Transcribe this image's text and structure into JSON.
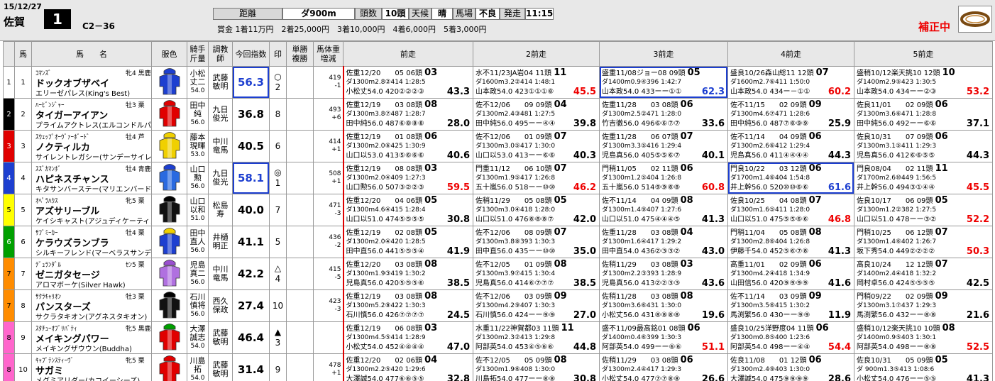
{
  "race": {
    "date": "15/12/27",
    "venue": "佐賀",
    "number": "1",
    "class": "C2－36",
    "dist_label": "距離",
    "dist": "ダ900m",
    "heads_label": "頭数",
    "heads": "10頭",
    "weather_label": "天候",
    "weather": "晴",
    "track_label": "馬場",
    "track": "不良",
    "start_label": "発走",
    "start": "11:15",
    "prize": "賞金 1着11万円　2着25,000円　3着10,000円　4着6,000円　5着3,000円",
    "hosei": "補正中"
  },
  "headers": {
    "waku": "",
    "ban": "馬",
    "horse": "馬　　名",
    "silks": "服色",
    "jockey": "騎手\n斤量",
    "trainer": "調教\n師",
    "index": "今回指数",
    "mark": "印",
    "odds": "単勝\n複勝",
    "bw": "馬体重\n増減",
    "prev1": "前走",
    "prev2": "2前走",
    "prev3": "3前走",
    "prev4": "4前走",
    "prev5": "5前走"
  },
  "waku_colors": [
    "#ffffff",
    "#000000",
    "#e00000",
    "#1d3fd0",
    "#ffff00",
    "#00a000",
    "#ff8c00",
    "#ff8c00",
    "#ff66cc",
    "#ff66cc"
  ],
  "horses": [
    {
      "waku": "1",
      "ban": "1",
      "sire": "ｺﾏﾝｽﾞ",
      "sex": "牝4 黒鹿",
      "name": "ドックオブザベイ",
      "dam": "エリーゼパレス(King's Best)",
      "jockey1": "小松",
      "jockey2": "丈二",
      "weight": "54.0",
      "trainer1": "武藤",
      "trainer2": "敏明",
      "index": "56.3",
      "idx_hl": true,
      "mark": "○",
      "mark_no": "2",
      "bw1": "419",
      "bw2": "-1",
      "prev": [
        {
          "l1": "佐重12/20　　05 06頭",
          "ord": "03",
          "l2": "ダ1300m2.8②414 1:28:5",
          "l3": "小松丈54.0 420②②②③",
          "v": "43.3",
          "vc": ""
        },
        {
          "l1": "水不11/23JA岩04 11頭",
          "ord": "11",
          "l2": "ダ1600m3.2②414 1:48:1",
          "l3": "山本政54.0 423①①①⑧",
          "v": "45.5",
          "vc": "red"
        },
        {
          "l1": "盛重11/08ジョー08 09頭",
          "ord": "05",
          "l2": "ダ1400m0.9④396 1:42:7",
          "l3": "山本政54.0 433ーー①①",
          "v": "62.3",
          "vc": "blue",
          "hl": true
        },
        {
          "l1": "盛良10/26森山総11 12頭",
          "ord": "07",
          "l2": "ダ1600m2.7⑥411 1:50:0",
          "l3": "山本政54.0 434ー－①①",
          "v": "60.2",
          "vc": "red"
        },
        {
          "l1": "盛稍10/12楽天挑10 12頭",
          "ord": "10",
          "l2": "ダ1400m2.9⑤423 1:30:5",
          "l3": "山本政54.0 434ーー②③",
          "v": "53.2",
          "vc": "red"
        }
      ]
    },
    {
      "waku": "2",
      "ban": "2",
      "sire": "ﾊｰﾋﾞﾝｼﾞｬｰ",
      "sex": "牡3 栗",
      "name": "タイガーアイアン",
      "dam": "プライムアクトレス(エルコンドルパサー)",
      "jockey1": "田中",
      "jockey2": "純",
      "weight": "56.0",
      "trainer1": "九日",
      "trainer2": "俊光",
      "index": "36.8",
      "idx_hl": false,
      "mark": "",
      "mark_no": "8",
      "bw1": "493",
      "bw2": "+6",
      "prev": [
        {
          "l1": "佐重12/19　　03 08頭",
          "ord": "08",
          "l2": "ダ1300m3.8⑦487 1:28:7",
          "l3": "田中純56.0 487⑥⑧⑧⑧",
          "v": "28.0",
          "vc": ""
        },
        {
          "l1": "佐不12/06　　09 09頭",
          "ord": "04",
          "l2": "ダ1300m2.4③481 1:27:5",
          "l3": "田中純56.0 495ーー④④",
          "v": "39.8",
          "vc": ""
        },
        {
          "l1": "佐重11/28　　03 08頭",
          "ord": "06",
          "l2": "ダ1300m2.5②471 1:28:0",
          "l3": "竹吉徹56.0 496⑥⑥⑦⑦",
          "v": "33.6",
          "vc": ""
        },
        {
          "l1": "佐不11/15　　02 09頭",
          "ord": "09",
          "l2": "ダ1300m4.6⑦471 1:28:6",
          "l3": "田中純56.0 487⑦⑧⑨⑨",
          "v": "25.9",
          "vc": ""
        },
        {
          "l1": "佐良11/01　　02 09頭",
          "ord": "06",
          "l2": "ダ1300m3.6⑥471 1:28:8",
          "l3": "田中純56.0 492ーー⑥⑥",
          "v": "37.1",
          "vc": ""
        }
      ]
    },
    {
      "waku": "3",
      "ban": "3",
      "sire": "ｽｳｪｯﾌﾟｵｰｳﾞｧｰﾎﾞｰﾄﾞ",
      "sex": "牡4 芦",
      "name": "ノクティルカ",
      "dam": "サイレントレガシー(サンデーサイレンス)",
      "jockey1": "藤本",
      "jockey2": "現暉",
      "weight": "53.0",
      "trainer1": "中川",
      "trainer2": "竜馬",
      "index": "40.5",
      "idx_hl": false,
      "mark": "",
      "mark_no": "6",
      "bw1": "414",
      "bw2": "+1",
      "prev": [
        {
          "l1": "佐重12/19　　01 08頭",
          "ord": "06",
          "l2": "ダ1300m2.0⑥425 1:30:9",
          "l3": "山口以53.0 413⑤⑥⑥⑥",
          "v": "40.6",
          "vc": ""
        },
        {
          "l1": "佐不12/06　　01 09頭",
          "ord": "07",
          "l2": "ダ1300m3.0⑤417 1:30:0",
          "l3": "山口以53.0 413ーー⑥⑥",
          "v": "40.3",
          "vc": ""
        },
        {
          "l1": "佐重11/28　　06 07頭",
          "ord": "07",
          "l2": "ダ1300m3.3⑤416 1:29:4",
          "l3": "児島真56.0 405⑤⑤⑥⑦",
          "v": "40.1",
          "vc": ""
        },
        {
          "l1": "佐不11/14　　04 09頭",
          "ord": "06",
          "l2": "ダ1300m2.6⑥412 1:29:4",
          "l3": "児島真56.0 411④④④④",
          "v": "44.3",
          "vc": ""
        },
        {
          "l1": "佐良10/31　　07 09頭",
          "ord": "06",
          "l2": "ダ1300m3.1⑤411 1:29:3",
          "l3": "児島真56.0 412⑥⑥⑤⑤",
          "v": "44.3",
          "vc": ""
        }
      ]
    },
    {
      "waku": "4",
      "ban": "4",
      "sire": "ｽｽﾞｶﾏﾝﾎﾞ",
      "sex": "牡4 青鹿",
      "name": "ハピネスチャンス",
      "dam": "キタサンバーステー(マリエンバード)",
      "jockey1": "山口",
      "jockey2": "勲",
      "weight": "56.0",
      "trainer1": "九日",
      "trainer2": "俊光",
      "index": "58.1",
      "idx_hl": true,
      "mark": "◎",
      "mark_no": "1",
      "bw1": "508",
      "bw2": "+1",
      "prev": [
        {
          "l1": "佐重12/19　　08 08頭",
          "ord": "03",
          "l2": "ダ1300m2.0④409 1:27:3",
          "l3": "山口勲56.0 507③②②③",
          "v": "59.5",
          "vc": "red"
        },
        {
          "l1": "門重11/12　　06 10頭",
          "ord": "07",
          "l2": "ダ1300m1.9⑤417 1:26:8",
          "l3": "五十嵐56.0 518ーー⑩⑩",
          "v": "46.2",
          "vc": "red"
        },
        {
          "l1": "門稍11/05　　02 11頭",
          "ord": "06",
          "l2": "ダ1300m1.2⑤404 1:26:8",
          "l3": "五十嵐56.0 514⑨⑨⑧⑧",
          "v": "60.8",
          "vc": "red"
        },
        {
          "l1": "門良10/22　　03 12頭",
          "ord": "06",
          "l2": "ダ1700m1.4⑥404 1:54:8",
          "l3": "井上幹56.0 520⑩⑩⑥⑥",
          "v": "61.6",
          "vc": "blue",
          "hl": true
        },
        {
          "l1": "門良08/04　　02 11頭",
          "ord": "11",
          "l2": "ダ1700m2.6⑩449 1:56:5",
          "l3": "井上幹56.0 494③①④④",
          "v": "45.5",
          "vc": "red"
        }
      ]
    },
    {
      "waku": "5",
      "ban": "5",
      "sire": "ｵﾍﾟﾗﾊｳｽ",
      "sex": "牝5 栗",
      "name": "アズサリーブル",
      "dam": "ケイシキャスト(アジュディケーティング)",
      "jockey1": "山口",
      "jockey2": "以和",
      "weight": "51.0",
      "trainer1": "松島",
      "trainer2": "寿",
      "index": "40.0",
      "idx_hl": false,
      "mark": "",
      "mark_no": "7",
      "bw1": "471",
      "bw2": "-3",
      "prev": [
        {
          "l1": "佐重12/20　　04 06頭",
          "ord": "05",
          "l2": "ダ1300m4.6④415 1:28:4",
          "l3": "山口以51.0 474⑤⑤⑤⑤",
          "v": "30.8",
          "vc": ""
        },
        {
          "l1": "佐稍11/29　　05 08頭",
          "ord": "05",
          "l2": "ダ1300m3.0④418 1:28:0",
          "l3": "山口以51.0 476⑧⑧⑧⑦",
          "v": "42.0",
          "vc": ""
        },
        {
          "l1": "佐不11/14　　04 09頭",
          "ord": "08",
          "l2": "ダ1300m1.4⑨407 1:27:6",
          "l3": "山口以51.0 475④④④⑤",
          "v": "41.3",
          "vc": ""
        },
        {
          "l1": "佐良10/25　　04 08頭",
          "ord": "07",
          "l2": "ダ1300m1.6⑤411 1:28:0",
          "l3": "山口以51.0 475⑤⑤⑥⑥",
          "v": "46.8",
          "vc": "red"
        },
        {
          "l1": "佐良10/17　　06 09頭",
          "ord": "05",
          "l2": "ダ1300m1.2②382 1:27:5",
          "l3": "山口以51.0 478ーー③②",
          "v": "52.2",
          "vc": "red"
        }
      ]
    },
    {
      "waku": "6",
      "ban": "6",
      "sire": "ｻﾌﾞﾐｰｶｰ",
      "sex": "牡4 栗",
      "name": "ケラウズランブラ",
      "dam": "シルキーフレンド(マーベラスサンデー)",
      "jockey1": "田中",
      "jockey2": "直人",
      "weight": "56.0",
      "trainer1": "井樋",
      "trainer2": "明正",
      "index": "41.1",
      "idx_hl": false,
      "mark": "",
      "mark_no": "5",
      "bw1": "436",
      "bw2": "-2",
      "prev": [
        {
          "l1": "佐重12/19　　02 08頭",
          "ord": "05",
          "l2": "ダ1300m2.0④420 1:28:5",
          "l3": "田中直56.0 441⑤⑤⑤④",
          "v": "41.9",
          "vc": ""
        },
        {
          "l1": "佐不12/06　　08 09頭",
          "ord": "07",
          "l2": "ダ1300m3.8⑧393 1:30:3",
          "l3": "田中直56.0 435ーー⑩⑩",
          "v": "35.0",
          "vc": ""
        },
        {
          "l1": "佐重11/28　　03 08頭",
          "ord": "04",
          "l2": "ダ1300m1.6④417 1:29:2",
          "l3": "田中直54.0 436②③③②",
          "v": "43.0",
          "vc": ""
        },
        {
          "l1": "門稍11/04　　05 08頭",
          "ord": "08",
          "l2": "ダ1300m2.8⑥404 1:26:8",
          "l3": "伊藤千54.0 452⑤⑥⑦⑧",
          "v": "41.3",
          "vc": ""
        },
        {
          "l1": "門稍10/25　　06 12頭",
          "ord": "07",
          "l2": "ダ1300m1.4⑥402 1:26:7",
          "l3": "坂下秀54.0 449②②②②",
          "v": "50.3",
          "vc": "red"
        }
      ]
    },
    {
      "waku": "7",
      "ban": "7",
      "sire": "ﾃﾞｭﾗﾝﾀﾞﾙ",
      "sex": "ｾﾝ5 栗",
      "name": "ゼニガタセージ",
      "dam": "アロマボーケ(Silver Hawk)",
      "jockey1": "児島",
      "jockey2": "真二",
      "weight": "56.0",
      "trainer1": "中川",
      "trainer2": "竜馬",
      "index": "42.2",
      "idx_hl": false,
      "mark": "△",
      "mark_no": "4",
      "bw1": "415",
      "bw2": "-5",
      "prev": [
        {
          "l1": "佐重12/20　　03 08頭",
          "ord": "08",
          "l2": "ダ1300m1.9③419 1:30:2",
          "l3": "児島真56.0 420⑤⑤⑤⑥",
          "v": "38.5",
          "vc": ""
        },
        {
          "l1": "佐不12/05　　01 09頭",
          "ord": "08",
          "l2": "ダ1300m3.9⑦415 1:30:4",
          "l3": "児島真56.0 414⑥⑦⑦⑦",
          "v": "38.5",
          "vc": ""
        },
        {
          "l1": "佐稍11/29　　03 08頭",
          "ord": "03",
          "l2": "ダ1300m2.2③393 1:28:9",
          "l3": "児島真56.0 413②②③③",
          "v": "43.6",
          "vc": ""
        },
        {
          "l1": "高重11/01　　02 09頭",
          "ord": "06",
          "l2": "ダ1300m4.2④418 1:34:9",
          "l3": "山田信56.0 420⑨⑨⑨⑨",
          "v": "41.6",
          "vc": ""
        },
        {
          "l1": "高良10/24　　12 12頭",
          "ord": "07",
          "l2": "ダ1400m2.4④418 1:32:2",
          "l3": "岡村卓56.0 424⑤⑤⑤⑤",
          "v": "42.5",
          "vc": ""
        }
      ]
    },
    {
      "waku": "7",
      "ban": "8",
      "sire": "ｻｸﾗｷｬﾘｵﾝ",
      "sex": "牡3 栗",
      "name": "パンスターズ",
      "dam": "サクラタキオン(アグネスタキオン)",
      "jockey1": "石川",
      "jockey2": "慎将",
      "weight": "56.0",
      "trainer1": "西久",
      "trainer2": "保政",
      "index": "27.4",
      "idx_hl": false,
      "mark": "",
      "mark_no": "10",
      "bw1": "423",
      "bw2": "-3",
      "prev": [
        {
          "l1": "佐重12/19　　03 08頭",
          "ord": "08",
          "l2": "ダ1300m5.2⑧422 1:30:3",
          "l3": "石川慎56.0 426⑦⑦⑦⑦",
          "v": "24.5",
          "vc": ""
        },
        {
          "l1": "佐不12/06　　03 09頭",
          "ord": "09",
          "l2": "ダ1300m4.2⑨407 1:30:3",
          "l3": "石川慎56.0 424ーー⑨⑨",
          "v": "27.0",
          "vc": ""
        },
        {
          "l1": "佐稍11/28　　03 08頭",
          "ord": "08",
          "l2": "ダ1300m3.6⑥431 1:30:0",
          "l3": "小松丈56.0 431⑧⑧⑧⑧",
          "v": "19.6",
          "vc": ""
        },
        {
          "l1": "佐不11/14　　03 09頭",
          "ord": "09",
          "l2": "ダ1300m3.5⑥415 1:30:2",
          "l3": "馬渕繁56.0 430ーー⑨⑨",
          "v": "11.9",
          "vc": ""
        },
        {
          "l1": "門稍09/22　　02 09頭",
          "ord": "09",
          "l2": "ダ1300m3.1⑦437 1:29:3",
          "l3": "馬渕繁56.0 432ーー⑧⑧",
          "v": "21.6",
          "vc": ""
        }
      ]
    },
    {
      "waku": "8",
      "ban": "9",
      "sire": "ｽﾀﾁｭｰｵﾌﾞﾘﾊﾞﾃｨ",
      "sex": "牝5 黒鹿",
      "name": "メイキングパワー",
      "dam": "メイキングザウウン(Buddha)",
      "jockey1": "大澤",
      "jockey2": "誠志",
      "weight": "54.0",
      "trainer1": "武藤",
      "trainer2": "敏明",
      "index": "46.4",
      "idx_hl": false,
      "mark": "▲",
      "mark_no": "3",
      "bw1": "",
      "bw2": "",
      "prev": [
        {
          "l1": "佐重12/19　　06 08頭",
          "ord": "03",
          "l2": "ダ1300m4.5⑤414 1:28:9",
          "l3": "小松丈54.0 452④④④④",
          "v": "47.0",
          "vc": ""
        },
        {
          "l1": "水重11/22神賀都03 11頭",
          "ord": "11",
          "l2": "ダ1300m2.3②413 1:29:8",
          "l3": "阿部英54.0 453④⑤⑥⑥",
          "v": "44.8",
          "vc": ""
        },
        {
          "l1": "盛不11/09最高銘01 08頭",
          "ord": "06",
          "l2": "ダ1400m0.4⑥399 1:30:3",
          "l3": "阿部英54.0 499ーー⑥⑥",
          "v": "51.1",
          "vc": "red"
        },
        {
          "l1": "盛良10/25洋野度04 11頭",
          "ord": "06",
          "l2": "ダ1300m0.8⑤400 1:23:6",
          "l3": "阿部英54.0 498ーー④④",
          "v": "54.4",
          "vc": "red"
        },
        {
          "l1": "盛稍10/12楽天挑10 10頭",
          "ord": "08",
          "l2": "ダ1400m0.9⑤403 1:30:1",
          "l3": "阿部英54.0 498ーー⑧⑧",
          "v": "52.5",
          "vc": "red"
        }
      ]
    },
    {
      "waku": "8",
      "ban": "10",
      "sire": "ｷｬﾌﾟﾃﾝｽﾃｨｰｳﾞ",
      "sex": "牝5 栗",
      "name": "サガミ",
      "dam": "メグミアリダー(カコイーシーズ)",
      "jockey1": "川島",
      "jockey2": "拓",
      "weight": "54.0",
      "trainer1": "武藤",
      "trainer2": "敏明",
      "index": "31.4",
      "idx_hl": false,
      "mark": "",
      "mark_no": "9",
      "bw1": "478",
      "bw2": "+1",
      "prev": [
        {
          "l1": "佐重12/20　　02 06頭",
          "ord": "04",
          "l2": "ダ1300m2.2⑤420 1:29:6",
          "l3": "大澤誠54.0 477⑥⑥⑤⑤",
          "v": "32.8",
          "vc": ""
        },
        {
          "l1": "佐不12/05　　05 09頭",
          "ord": "08",
          "l2": "ダ1300m1.9⑥408 1:30:0",
          "l3": "川島拓54.0 477ーー⑧⑧",
          "v": "30.8",
          "vc": ""
        },
        {
          "l1": "佐稍11/29　　03 08頭",
          "ord": "06",
          "l2": "ダ1300m2.4④417 1:29:3",
          "l3": "小松丈54.0 477⑦⑦⑧⑧",
          "v": "26.6",
          "vc": ""
        },
        {
          "l1": "佐良11/08　　01 12頭",
          "ord": "06",
          "l2": "ダ1300m2.4⑨403 1:30:0",
          "l3": "大澤誠54.0 475⑨⑨⑨⑨",
          "v": "28.6",
          "vc": ""
        },
        {
          "l1": "佐良10/31　　05 09頭",
          "ord": "05",
          "l2": "ダ 900m1.3⑤413 1:08:6",
          "l3": "小松丈54.0 476ーー⑤⑤",
          "v": "41.3",
          "vc": ""
        }
      ]
    }
  ]
}
